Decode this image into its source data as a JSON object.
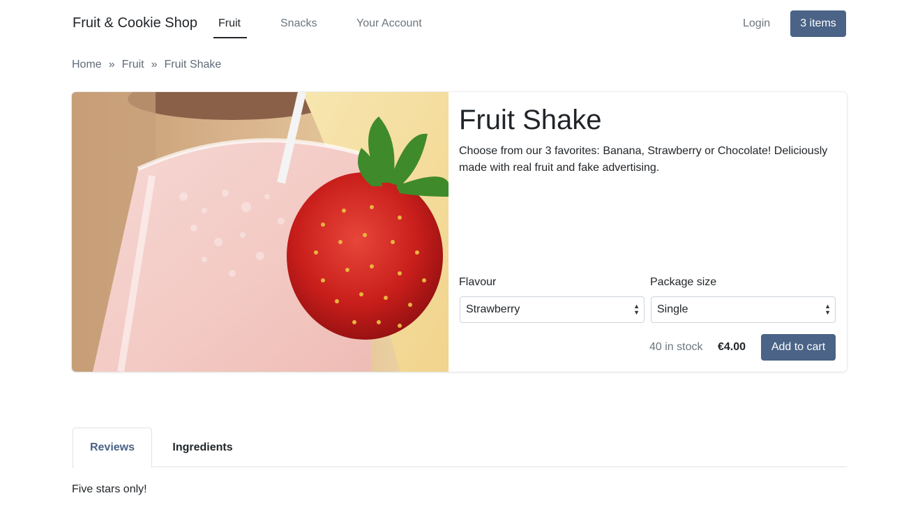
{
  "nav": {
    "brand": "Fruit & Cookie Shop",
    "links": [
      {
        "label": "Fruit",
        "active": true
      },
      {
        "label": "Snacks",
        "active": false
      },
      {
        "label": "Your Account",
        "active": false
      }
    ],
    "login_label": "Login",
    "cart_label": "3 items"
  },
  "breadcrumb": {
    "items": [
      "Home",
      "Fruit",
      "Fruit Shake"
    ],
    "separator": "»"
  },
  "product": {
    "title": "Fruit Shake",
    "description": "Choose from our 3 favorites: Banana, Strawberry or Chocolate! Deliciously made with real fruit and fake advertising.",
    "flavour_label": "Flavour",
    "flavour_value": "Strawberry",
    "package_label": "Package size",
    "package_value": "Single",
    "stock_text": "40 in stock",
    "price": "€4.00",
    "add_to_cart_label": "Add to cart"
  },
  "tabs": {
    "items": [
      {
        "label": "Reviews",
        "active": true
      },
      {
        "label": "Ingredients",
        "active": false
      }
    ],
    "content": "Five stars only!"
  },
  "colors": {
    "accent": "#4a6386",
    "muted_text": "#6c757d",
    "text": "#212529"
  },
  "icons": {
    "select_arrows": "updown-arrows-icon"
  }
}
